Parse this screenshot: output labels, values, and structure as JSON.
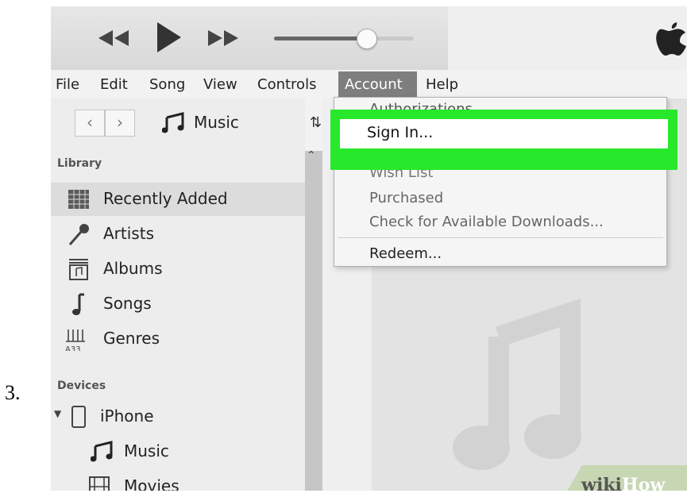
{
  "step": {
    "number": "3."
  },
  "menubar": {
    "items": [
      {
        "label": "File"
      },
      {
        "label": "Edit"
      },
      {
        "label": "Song"
      },
      {
        "label": "View"
      },
      {
        "label": "Controls"
      },
      {
        "label": "Account"
      },
      {
        "label": "Help"
      }
    ]
  },
  "toolbar": {
    "icons": [
      "rewind-icon",
      "play-icon",
      "fast-forward-icon",
      "apple-logo-icon"
    ],
    "volume_level": 0.66
  },
  "sidebar": {
    "media_selector": {
      "label": "Music",
      "icon": "music-note-icon"
    },
    "library_heading": "Library",
    "library_items": [
      {
        "label": "Recently Added",
        "icon": "grid-icon",
        "selected": true
      },
      {
        "label": "Artists",
        "icon": "microphone-icon"
      },
      {
        "label": "Albums",
        "icon": "album-icon"
      },
      {
        "label": "Songs",
        "icon": "note-icon"
      },
      {
        "label": "Genres",
        "icon": "genres-icon"
      }
    ],
    "devices_heading": "Devices",
    "device": {
      "label": "iPhone",
      "icon": "iphone-icon"
    },
    "device_items": [
      {
        "label": "Music",
        "icon": "music-note-icon"
      },
      {
        "label": "Movies",
        "icon": "film-icon"
      }
    ]
  },
  "account_menu": {
    "items": [
      {
        "label": "Authorizations",
        "partially_hidden": true
      },
      {
        "label": "Sign In...",
        "highlighted": true
      },
      {
        "label": "Wish List",
        "partially_hidden": true
      },
      {
        "label": "Purchased"
      },
      {
        "label": "Check for Available Downloads..."
      },
      {
        "label": "Redeem..."
      }
    ]
  },
  "watermark": {
    "part1": "wiki",
    "part2": "How"
  },
  "colors": {
    "highlight": "#27e82b",
    "menu_active": "#7e7e7e"
  }
}
